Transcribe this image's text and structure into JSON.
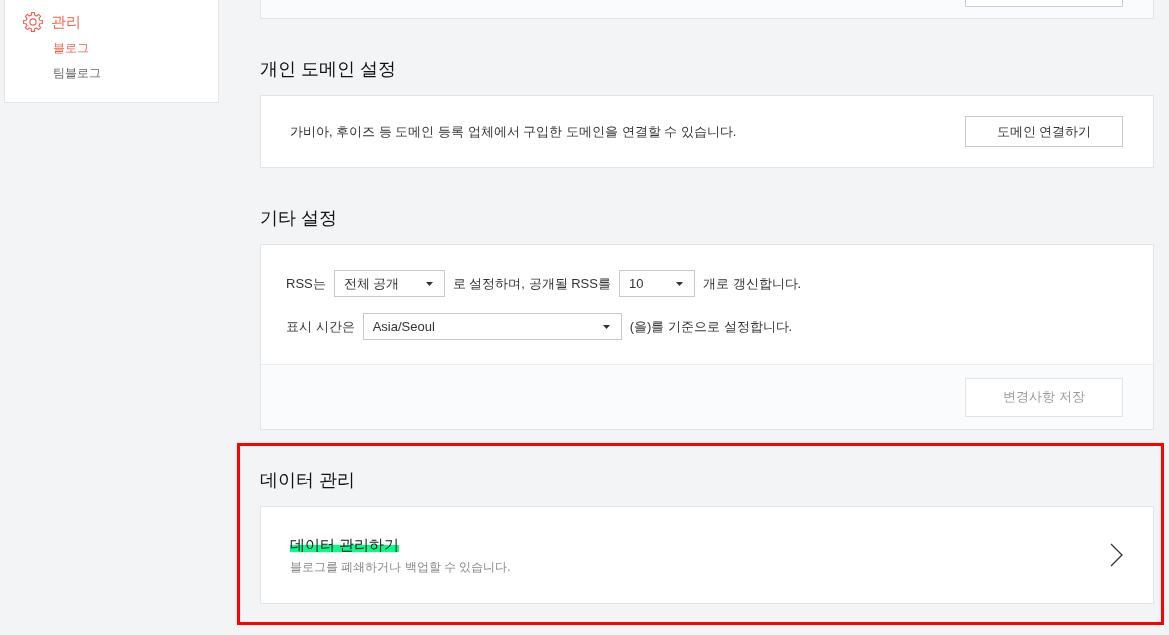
{
  "sidebar": {
    "menu": {
      "label": "관리",
      "items": [
        {
          "label": "블로그",
          "selected": true
        },
        {
          "label": "팀블로그",
          "selected": false
        }
      ]
    }
  },
  "domain_section": {
    "title": "개인 도메인 설정",
    "description": "가비아, 후이즈 등 도메인 등록 업체에서 구입한 도메인을 연결할 수 있습니다.",
    "button": "도메인 연결하기"
  },
  "other_settings": {
    "title": "기타 설정",
    "rows": [
      {
        "parts": [
          {
            "kind": "text",
            "text": "RSS는"
          },
          {
            "kind": "select",
            "value": "전체 공개"
          },
          {
            "kind": "text",
            "text": "로 설정하며, 공개될 RSS를"
          },
          {
            "kind": "select",
            "value": "10"
          },
          {
            "kind": "text",
            "text": "개로 갱신합니다."
          }
        ]
      },
      {
        "parts": [
          {
            "kind": "text",
            "text": "표시 시간은"
          },
          {
            "kind": "select",
            "value": "Asia/Seoul"
          },
          {
            "kind": "text",
            "text": "(을)를 기준으로 설정합니다."
          }
        ]
      }
    ],
    "save_button": {
      "label": "변경사항 저장",
      "disabled": true
    }
  },
  "data_section": {
    "title": "데이터 관리",
    "highlighted": true,
    "link": {
      "title": "데이터 관리하기",
      "title_highlighted": true,
      "description": "블로그를 폐쇄하거나 백업할 수 있습니다."
    }
  }
}
